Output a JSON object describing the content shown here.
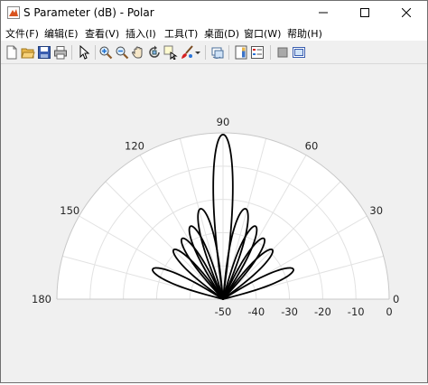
{
  "window": {
    "title": "S Parameter (dB) - Polar",
    "controls": [
      "minimize",
      "maximize",
      "close"
    ]
  },
  "menu": [
    {
      "label": "文件(F)"
    },
    {
      "label": "编辑(E)"
    },
    {
      "label": "查看(V)"
    },
    {
      "label": "插入(I)"
    },
    {
      "label": "工具(T)"
    },
    {
      "label": "桌面(D)"
    },
    {
      "label": "窗口(W)"
    },
    {
      "label": "帮助(H)"
    }
  ],
  "toolbar": {
    "icons": [
      "new-figure-icon",
      "open-file-icon",
      "save-icon",
      "print-icon",
      "edit-plot-arrow-icon",
      "zoom-in-icon",
      "zoom-out-icon",
      "pan-icon",
      "rotate-3d-icon",
      "data-cursor-icon",
      "brush-icon",
      "brush-dropdown-icon",
      "link-plot-icon",
      "insert-colorbar-icon",
      "insert-legend-icon",
      "hide-plot-tools-icon",
      "show-plot-tools-icon"
    ]
  },
  "chart_data": {
    "type": "polar-line",
    "angle_ticks_deg": [
      "0",
      "30",
      "60",
      "90",
      "120",
      "150",
      "180"
    ],
    "radial_ticks_db": [
      "-50",
      "-40",
      "-30",
      "-20",
      "-10",
      "0"
    ],
    "r_range_db": [
      -50,
      0
    ],
    "theta_range_deg": [
      0,
      180
    ],
    "grid": true,
    "series_color": "#000000",
    "pattern": {
      "main_lobe": {
        "angle_deg": 90,
        "peak_db": -0.5
      },
      "side_lobes": [
        {
          "angle_deg": 76,
          "peak_db": -22
        },
        {
          "angle_deg": 104,
          "peak_db": -22
        },
        {
          "angle_deg": 66,
          "peak_db": -26
        },
        {
          "angle_deg": 114,
          "peak_db": -26
        },
        {
          "angle_deg": 56,
          "peak_db": -28
        },
        {
          "angle_deg": 124,
          "peak_db": -28
        },
        {
          "angle_deg": 45,
          "peak_db": -29
        },
        {
          "angle_deg": 135,
          "peak_db": -29
        },
        {
          "angle_deg": 23,
          "peak_db": -27
        },
        {
          "angle_deg": 157,
          "peak_db": -27
        }
      ]
    }
  }
}
